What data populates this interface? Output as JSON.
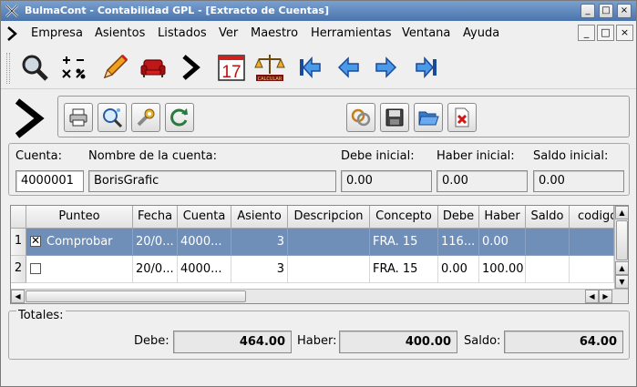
{
  "window": {
    "title": "BulmaCont - Contabilidad GPL - [Extracto de Cuentas]"
  },
  "titlebar_buttons": {
    "minimize": "_",
    "maximize": "□",
    "close": "×"
  },
  "menubar": {
    "items": [
      {
        "label": "Empresa"
      },
      {
        "label": "Asientos"
      },
      {
        "label": "Listados"
      },
      {
        "label": "Ver"
      },
      {
        "label": "Maestro"
      },
      {
        "label": "Herramientas"
      },
      {
        "label": "Ventana"
      },
      {
        "label": "Ayuda"
      }
    ]
  },
  "toolbar": {
    "calendar_day": "17",
    "balance_tag": "CALCULAR",
    "icons": [
      "search-icon",
      "calculator-icon",
      "pencil-icon",
      "armchair-icon",
      "chevron-icon",
      "calendar-icon",
      "balance-scale-icon",
      "first-icon",
      "previous-icon",
      "next-icon",
      "last-icon"
    ]
  },
  "subtoolbar": {
    "icons": [
      "print-icon",
      "search-zoom-icon",
      "settings-icon",
      "refresh-icon",
      "link-icon",
      "save-icon",
      "open-folder-icon",
      "close-doc-icon"
    ]
  },
  "account": {
    "cuenta_label": "Cuenta:",
    "cuenta_value": "4000001",
    "nombre_label": "Nombre de la cuenta:",
    "nombre_value": "BorisGrafic",
    "debe_label": "Debe inicial:",
    "debe_value": "0.00",
    "haber_label": "Haber inicial:",
    "haber_value": "0.00",
    "saldo_label": "Saldo inicial:",
    "saldo_value": "0.00"
  },
  "table": {
    "headers": [
      "Punteo",
      "Fecha",
      "Cuenta",
      "Asiento",
      "Descripcion",
      "Concepto",
      "Debe",
      "Haber",
      "Saldo",
      "codigob"
    ],
    "rows": [
      {
        "num": "1",
        "checked": true,
        "punteo": "Comprobar",
        "fecha": "20/0...",
        "cuenta": "4000...",
        "asiento": "3",
        "descripcion": "",
        "concepto": "FRA. 15",
        "debe": "116...",
        "haber": "0.00",
        "saldo": "",
        "codigob": ""
      },
      {
        "num": "2",
        "checked": false,
        "punteo": "",
        "fecha": "20/0...",
        "cuenta": "4000...",
        "asiento": "3",
        "descripcion": "",
        "concepto": "FRA. 15",
        "debe": "0.00",
        "haber": "100.00",
        "saldo": "",
        "codigob": ""
      }
    ]
  },
  "totals": {
    "title": "Totales:",
    "debe_label": "Debe:",
    "debe_value": "464.00",
    "haber_label": "Haber:",
    "haber_value": "400.00",
    "saldo_label": "Saldo:",
    "saldo_value": "64.00"
  },
  "colors": {
    "titlebar": "#4a74ae",
    "selection": "#6f8fb8",
    "background": "#efefef"
  }
}
